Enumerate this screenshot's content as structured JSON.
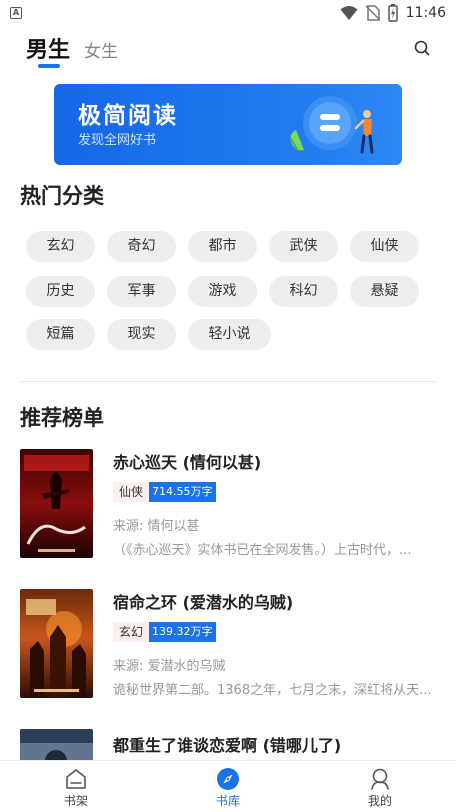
{
  "status_bar": {
    "app_badge": "A",
    "time": "11:46",
    "icons": [
      "wifi-icon",
      "no-sim-icon",
      "battery-charging-icon"
    ]
  },
  "header": {
    "tabs": [
      {
        "label": "男生",
        "active": true
      },
      {
        "label": "女生",
        "active": false
      }
    ],
    "search_icon": "search-icon"
  },
  "banner": {
    "title": "极简阅读",
    "subtitle": "发现全网好书"
  },
  "categories": {
    "title": "热门分类",
    "items": [
      "玄幻",
      "奇幻",
      "都市",
      "武侠",
      "仙侠",
      "历史",
      "军事",
      "游戏",
      "科幻",
      "悬疑",
      "短篇",
      "现实",
      "轻小说"
    ]
  },
  "recommend": {
    "title": "推荐榜单",
    "books": [
      {
        "title": "赤心巡天 (情何以甚)",
        "category": "仙侠",
        "words": "714.55万字",
        "source": "来源: 情何以甚",
        "desc": "（《赤心巡天》实体书已在全网发售。）上古时代，...",
        "cover_text": "赤心巡天"
      },
      {
        "title": "宿命之环 (爱潜水的乌贼)",
        "category": "玄幻",
        "words": "139.32万字",
        "source": "来源: 爱潜水的乌贼",
        "desc": "诡秘世界第二部。1368之年，七月之末，深红将从天...",
        "cover_text": "宿命之环"
      },
      {
        "title": "都重生了谁谈恋爱啊 (错哪儿了)"
      }
    ]
  },
  "bottom_nav": {
    "items": [
      {
        "label": "书架",
        "icon": "bookshelf-icon",
        "active": false
      },
      {
        "label": "书库",
        "icon": "compass-icon",
        "active": true
      },
      {
        "label": "我的",
        "icon": "profile-icon",
        "active": false
      }
    ],
    "active_color": "#1a73e8"
  },
  "colors": {
    "accent": "#1a73e8",
    "chip_bg": "#eeeeee",
    "tag_category_bg": "#fdeef0"
  }
}
